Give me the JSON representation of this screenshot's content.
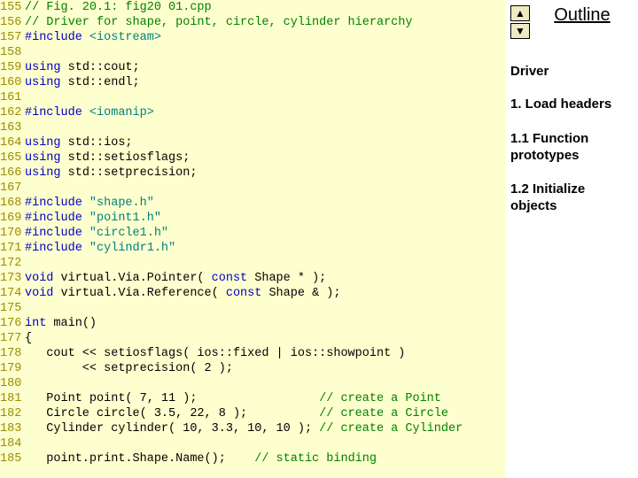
{
  "outline": {
    "title": "Outline",
    "arrow_up": "▲",
    "arrow_down": "▼"
  },
  "sidebar": {
    "driver": "Driver",
    "s1": "1. Load headers",
    "s11": "1.1 Function prototypes",
    "s12": "1.2 Initialize objects"
  },
  "code": {
    "lines": [
      {
        "n": "155",
        "segs": [
          {
            "cls": "c-comment",
            "t": "// Fig. 20.1: fig20 01.cpp"
          }
        ]
      },
      {
        "n": "156",
        "segs": [
          {
            "cls": "c-comment",
            "t": "// Driver for shape, point, circle, cylinder hierarchy"
          }
        ]
      },
      {
        "n": "157",
        "segs": [
          {
            "cls": "c-pp",
            "t": "#include "
          },
          {
            "cls": "c-str",
            "t": "<iostream>"
          }
        ]
      },
      {
        "n": "158",
        "segs": [
          {
            "cls": "c-text",
            "t": ""
          }
        ]
      },
      {
        "n": "159",
        "segs": [
          {
            "cls": "c-kw",
            "t": "using"
          },
          {
            "cls": "c-text",
            "t": " std::cout;"
          }
        ]
      },
      {
        "n": "160",
        "segs": [
          {
            "cls": "c-kw",
            "t": "using"
          },
          {
            "cls": "c-text",
            "t": " std::endl;"
          }
        ]
      },
      {
        "n": "161",
        "segs": [
          {
            "cls": "c-text",
            "t": ""
          }
        ]
      },
      {
        "n": "162",
        "segs": [
          {
            "cls": "c-pp",
            "t": "#include "
          },
          {
            "cls": "c-str",
            "t": "<iomanip>"
          }
        ]
      },
      {
        "n": "163",
        "segs": [
          {
            "cls": "c-text",
            "t": ""
          }
        ]
      },
      {
        "n": "164",
        "segs": [
          {
            "cls": "c-kw",
            "t": "using"
          },
          {
            "cls": "c-text",
            "t": " std::ios;"
          }
        ]
      },
      {
        "n": "165",
        "segs": [
          {
            "cls": "c-kw",
            "t": "using"
          },
          {
            "cls": "c-text",
            "t": " std::setiosflags;"
          }
        ]
      },
      {
        "n": "166",
        "segs": [
          {
            "cls": "c-kw",
            "t": "using"
          },
          {
            "cls": "c-text",
            "t": " std::setprecision;"
          }
        ]
      },
      {
        "n": "167",
        "segs": [
          {
            "cls": "c-text",
            "t": ""
          }
        ]
      },
      {
        "n": "168",
        "segs": [
          {
            "cls": "c-pp",
            "t": "#include "
          },
          {
            "cls": "c-str",
            "t": "\"shape.h\""
          }
        ]
      },
      {
        "n": "169",
        "segs": [
          {
            "cls": "c-pp",
            "t": "#include "
          },
          {
            "cls": "c-str",
            "t": "\"point1.h\""
          }
        ]
      },
      {
        "n": "170",
        "segs": [
          {
            "cls": "c-pp",
            "t": "#include "
          },
          {
            "cls": "c-str",
            "t": "\"circle1.h\""
          }
        ]
      },
      {
        "n": "171",
        "segs": [
          {
            "cls": "c-pp",
            "t": "#include "
          },
          {
            "cls": "c-str",
            "t": "\"cylindr1.h\""
          }
        ]
      },
      {
        "n": "172",
        "segs": [
          {
            "cls": "c-text",
            "t": ""
          }
        ]
      },
      {
        "n": "173",
        "segs": [
          {
            "cls": "c-kw",
            "t": "void"
          },
          {
            "cls": "c-text",
            "t": " virtual.Via.Pointer( "
          },
          {
            "cls": "c-const",
            "t": "const"
          },
          {
            "cls": "c-text",
            "t": " Shape * );"
          }
        ]
      },
      {
        "n": "174",
        "segs": [
          {
            "cls": "c-kw",
            "t": "void"
          },
          {
            "cls": "c-text",
            "t": " virtual.Via.Reference( "
          },
          {
            "cls": "c-const",
            "t": "const"
          },
          {
            "cls": "c-text",
            "t": " Shape & );"
          }
        ]
      },
      {
        "n": "175",
        "segs": [
          {
            "cls": "c-text",
            "t": ""
          }
        ]
      },
      {
        "n": "176",
        "segs": [
          {
            "cls": "c-kw",
            "t": "int"
          },
          {
            "cls": "c-text",
            "t": " main()"
          }
        ]
      },
      {
        "n": "177",
        "segs": [
          {
            "cls": "c-text",
            "t": "{"
          }
        ]
      },
      {
        "n": "178",
        "segs": [
          {
            "cls": "c-text",
            "t": "   cout << setiosflags( ios::fixed | ios::showpoint )"
          }
        ]
      },
      {
        "n": "179",
        "segs": [
          {
            "cls": "c-text",
            "t": "        << setprecision( 2 );"
          }
        ]
      },
      {
        "n": "180",
        "segs": [
          {
            "cls": "c-text",
            "t": ""
          }
        ]
      },
      {
        "n": "181",
        "segs": [
          {
            "cls": "c-text",
            "t": "   Point point( 7, 11 );                 "
          },
          {
            "cls": "c-comment",
            "t": "// create a Point"
          }
        ]
      },
      {
        "n": "182",
        "segs": [
          {
            "cls": "c-text",
            "t": "   Circle circle( 3.5, 22, 8 );          "
          },
          {
            "cls": "c-comment",
            "t": "// create a Circle"
          }
        ]
      },
      {
        "n": "183",
        "segs": [
          {
            "cls": "c-text",
            "t": "   Cylinder cylinder( 10, 3.3, 10, 10 ); "
          },
          {
            "cls": "c-comment",
            "t": "// create a Cylinder"
          }
        ]
      },
      {
        "n": "184",
        "segs": [
          {
            "cls": "c-text",
            "t": ""
          }
        ]
      },
      {
        "n": "185",
        "segs": [
          {
            "cls": "c-text",
            "t": "   point.print.Shape.Name();    "
          },
          {
            "cls": "c-comment",
            "t": "// static binding"
          }
        ]
      }
    ]
  }
}
